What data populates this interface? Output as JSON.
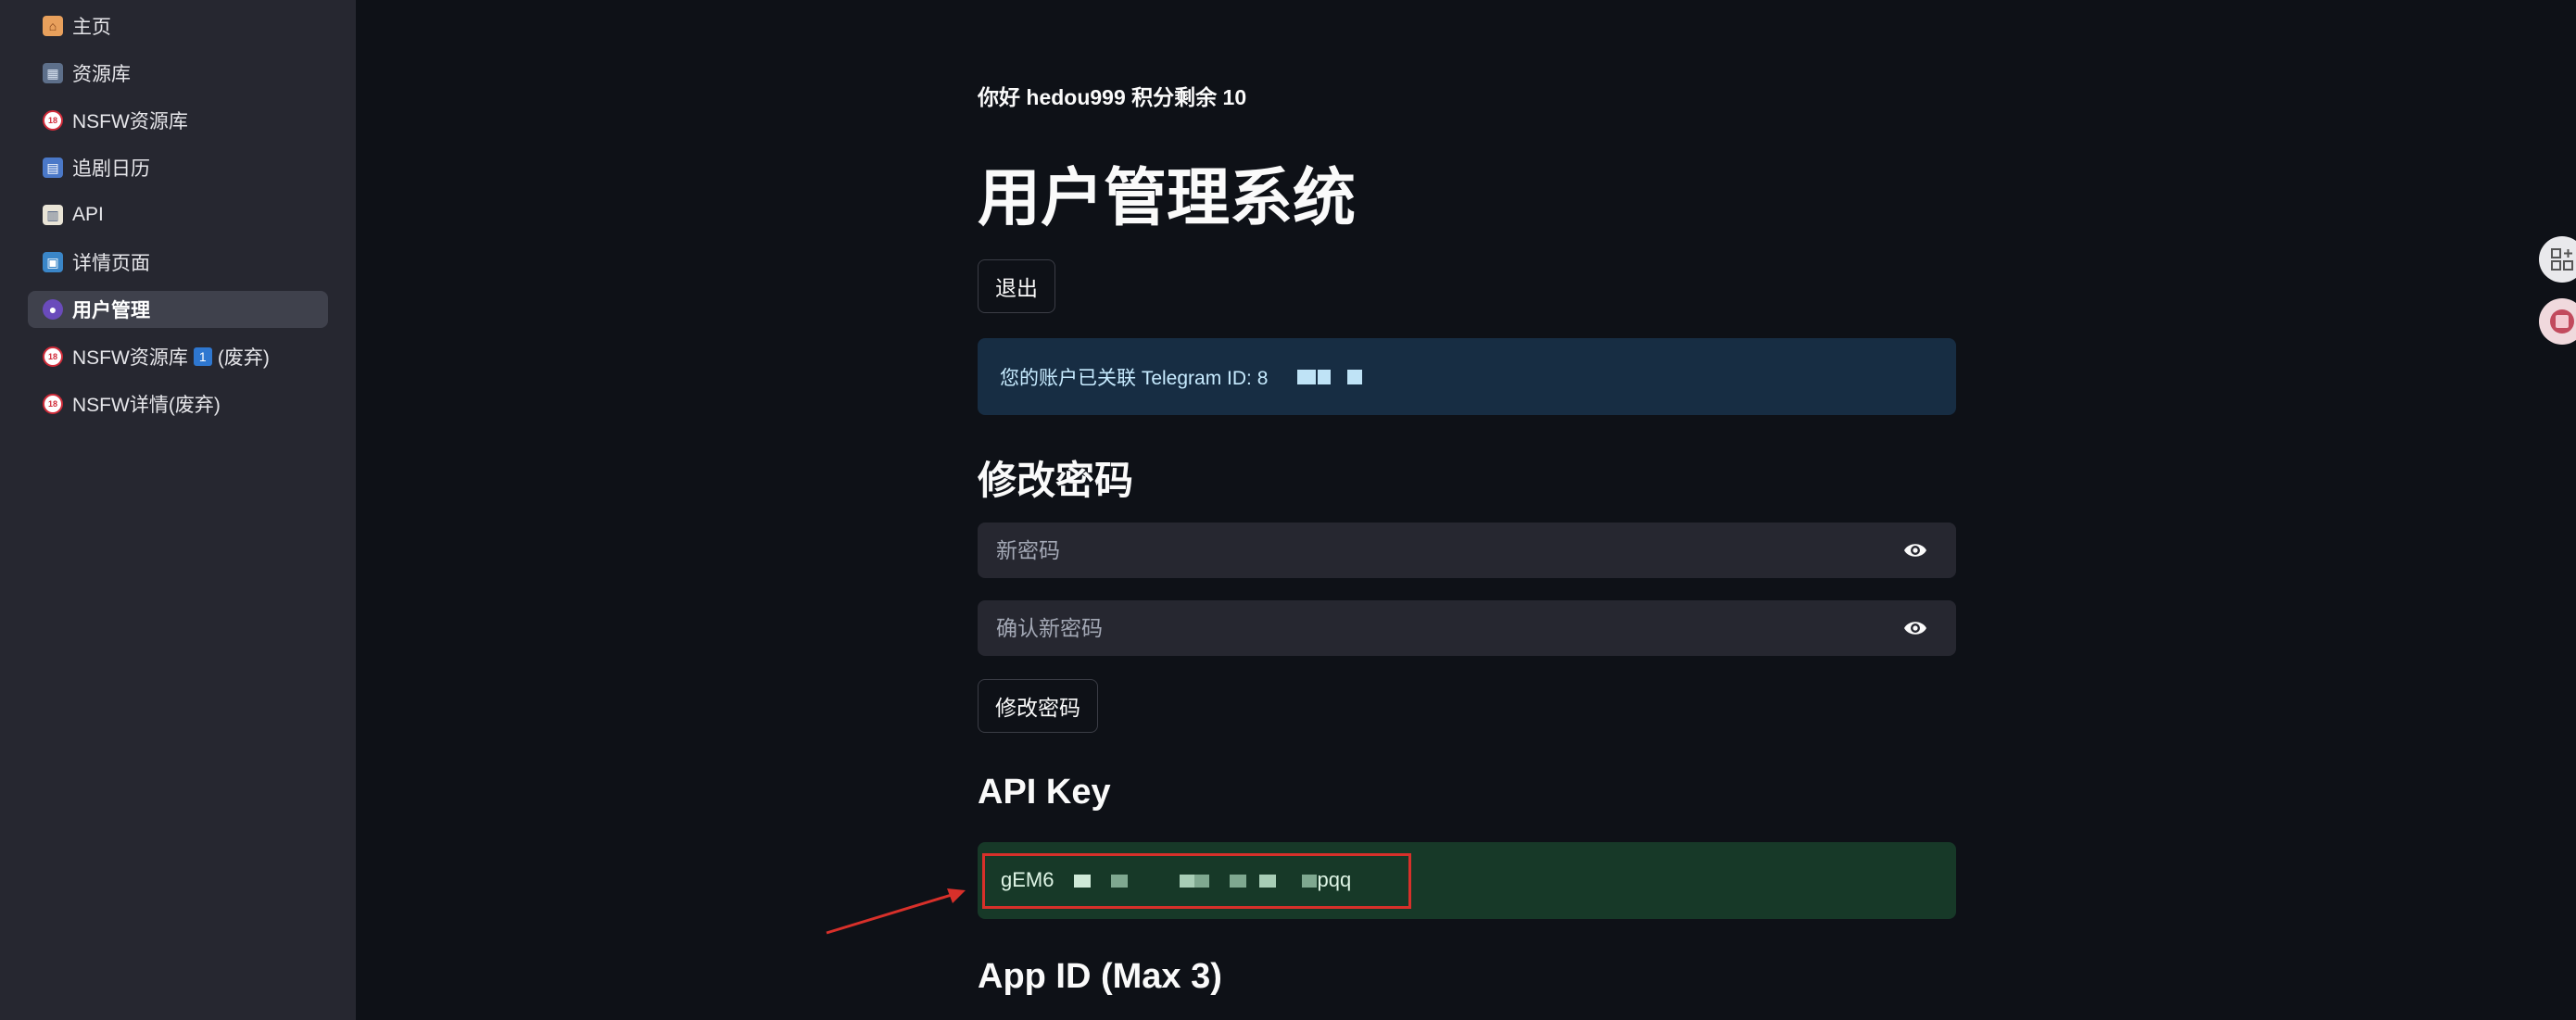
{
  "sidebar": {
    "items": [
      {
        "label": "主页",
        "icon": "house-icon"
      },
      {
        "label": "资源库",
        "icon": "film-icon"
      },
      {
        "label": "NSFW资源库",
        "icon": "no-under-18-icon"
      },
      {
        "label": "追剧日历",
        "icon": "calendar-icon"
      },
      {
        "label": "API",
        "icon": "book-icon"
      },
      {
        "label": "详情页面",
        "icon": "picture-icon"
      },
      {
        "label": "用户管理",
        "icon": "person-icon",
        "active": true
      },
      {
        "label": "NSFW资源库",
        "suffix": "(废弃)",
        "badge": "1",
        "icon": "no-under-18-icon"
      },
      {
        "label": "NSFW详情(废弃)",
        "icon": "no-under-18-icon"
      }
    ]
  },
  "main": {
    "greeting": "你好 hedou999 积分剩余 10",
    "title": "用户管理系统",
    "logout_label": "退出",
    "telegram_info": "您的账户已关联 Telegram ID: 8",
    "change_password_heading": "修改密码",
    "new_password_placeholder": "新密码",
    "confirm_password_placeholder": "确认新密码",
    "change_password_button": "修改密码",
    "api_key_heading": "API Key",
    "api_key_prefix": "gEM6",
    "api_key_suffix": "pqq",
    "app_id_heading": "App ID (Max 3)"
  },
  "colors": {
    "background": "#0e1117",
    "sidebar": "#262730",
    "info_box": "#172d43",
    "success_box": "#173928",
    "annotation_red": "#d8302a"
  }
}
